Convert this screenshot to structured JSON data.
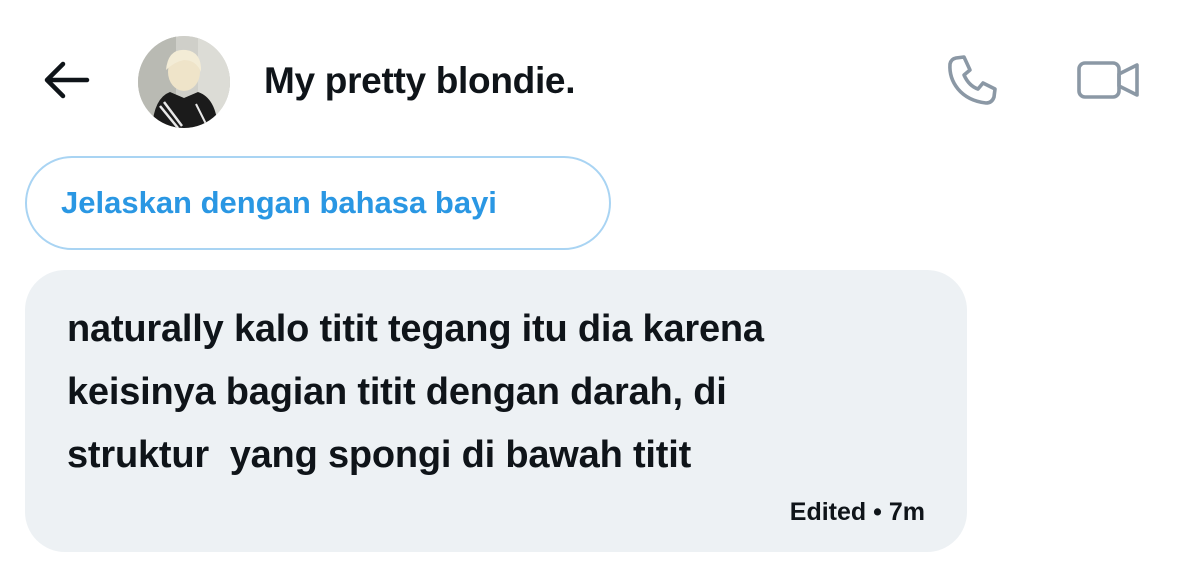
{
  "header": {
    "title": "My pretty blondie.",
    "back_icon": "arrow-left-icon",
    "call_icon": "phone-icon",
    "video_icon": "video-camera-icon"
  },
  "suggestion": {
    "label": "Jelaskan dengan bahasa bayi"
  },
  "message": {
    "lines": [
      "naturally kalo titit tegang itu dia karena",
      "keisinya bagian titit dengan darah, di",
      "struktur  yang spongi di bawah titit"
    ],
    "status": "Edited",
    "separator": "•",
    "time": "7m"
  },
  "colors": {
    "accent": "#1d9bf0",
    "bubble_bg": "#edf1f4",
    "text": "#0f1419",
    "icon_gray": "#8b98a5"
  }
}
